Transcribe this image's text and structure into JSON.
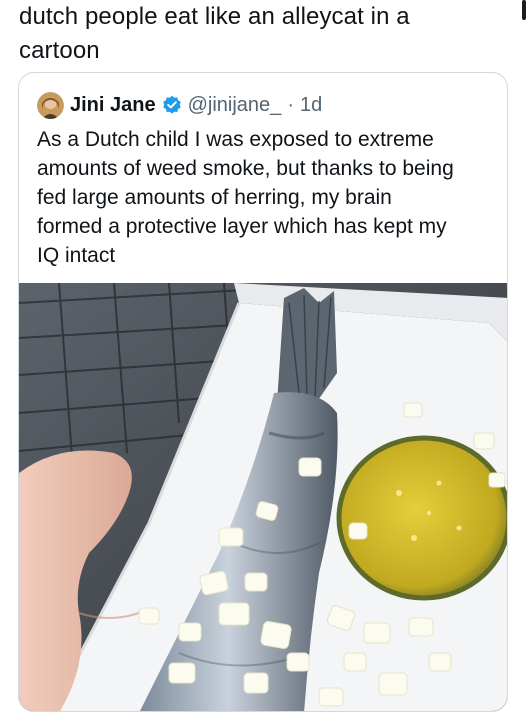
{
  "post": {
    "text": "dutch people eat like an alleycat in a\ncartoon"
  },
  "quote": {
    "author_name": "Jini Jane",
    "author_handle": "@jinijane_",
    "separator": "·",
    "time": "1d",
    "verified_icon": "verified-badge-icon",
    "text": "As a Dutch child I was exposed to extreme\namounts of weed smoke, but thanks to being\nfed large amounts of herring, my brain\nformed a protective layer which has kept my\nIQ intact"
  },
  "colors": {
    "text": "#0f1419",
    "secondary_text": "#536471",
    "card_border": "#cfd9de",
    "verified_blue": "#1d9bf0"
  }
}
